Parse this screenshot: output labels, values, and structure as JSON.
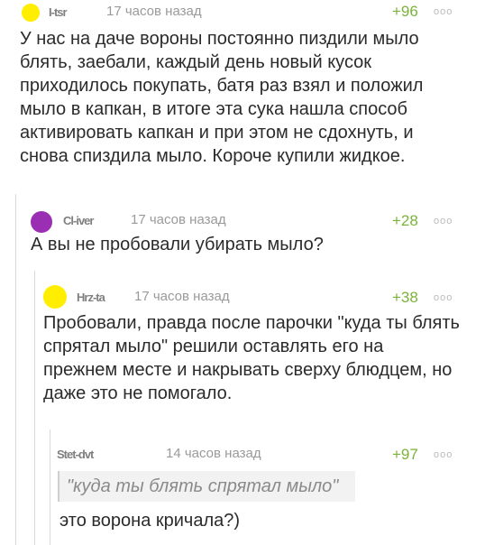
{
  "comments": [
    {
      "nick": "I-tsr",
      "time": "17 часов назад",
      "rating": "+96",
      "more": "ооо",
      "text": "У нас на даче вороны постоянно пиздили мыло блять, заебали, каждый день новый кусок приходилось покупать, батя раз взял и положил мыло в капкан, в итоге эта сука нашла способ активировать капкан и при этом не сдохнуть, и снова спиздила мыло. Короче купили жидкое."
    },
    {
      "nick": "Cl-iver",
      "time": "17 часов назад",
      "rating": "+28",
      "more": "ооо",
      "text": "А вы не пробовали убирать мыло?"
    },
    {
      "nick": "Hrz-ta",
      "time": "17 часов назад",
      "rating": "+38",
      "more": "ооо",
      "text": "Пробовали, правда после парочки \"куда ты блять спрятал мыло\" решили оставлять его на прежнем месте и накрывать сверху блюдцем, но даже это не помогало."
    },
    {
      "nick": "Stet-dvt",
      "time": "14 часов назад",
      "rating": "+97",
      "more": "ооо",
      "quote": "\"куда ты блять спрятал мыло\"",
      "text": "это ворона кричала?)"
    }
  ],
  "colors": {
    "avatar_yellow": "#ffee00",
    "avatar_purple": "#9a2fb3",
    "rating_green": "#7bb33a"
  }
}
